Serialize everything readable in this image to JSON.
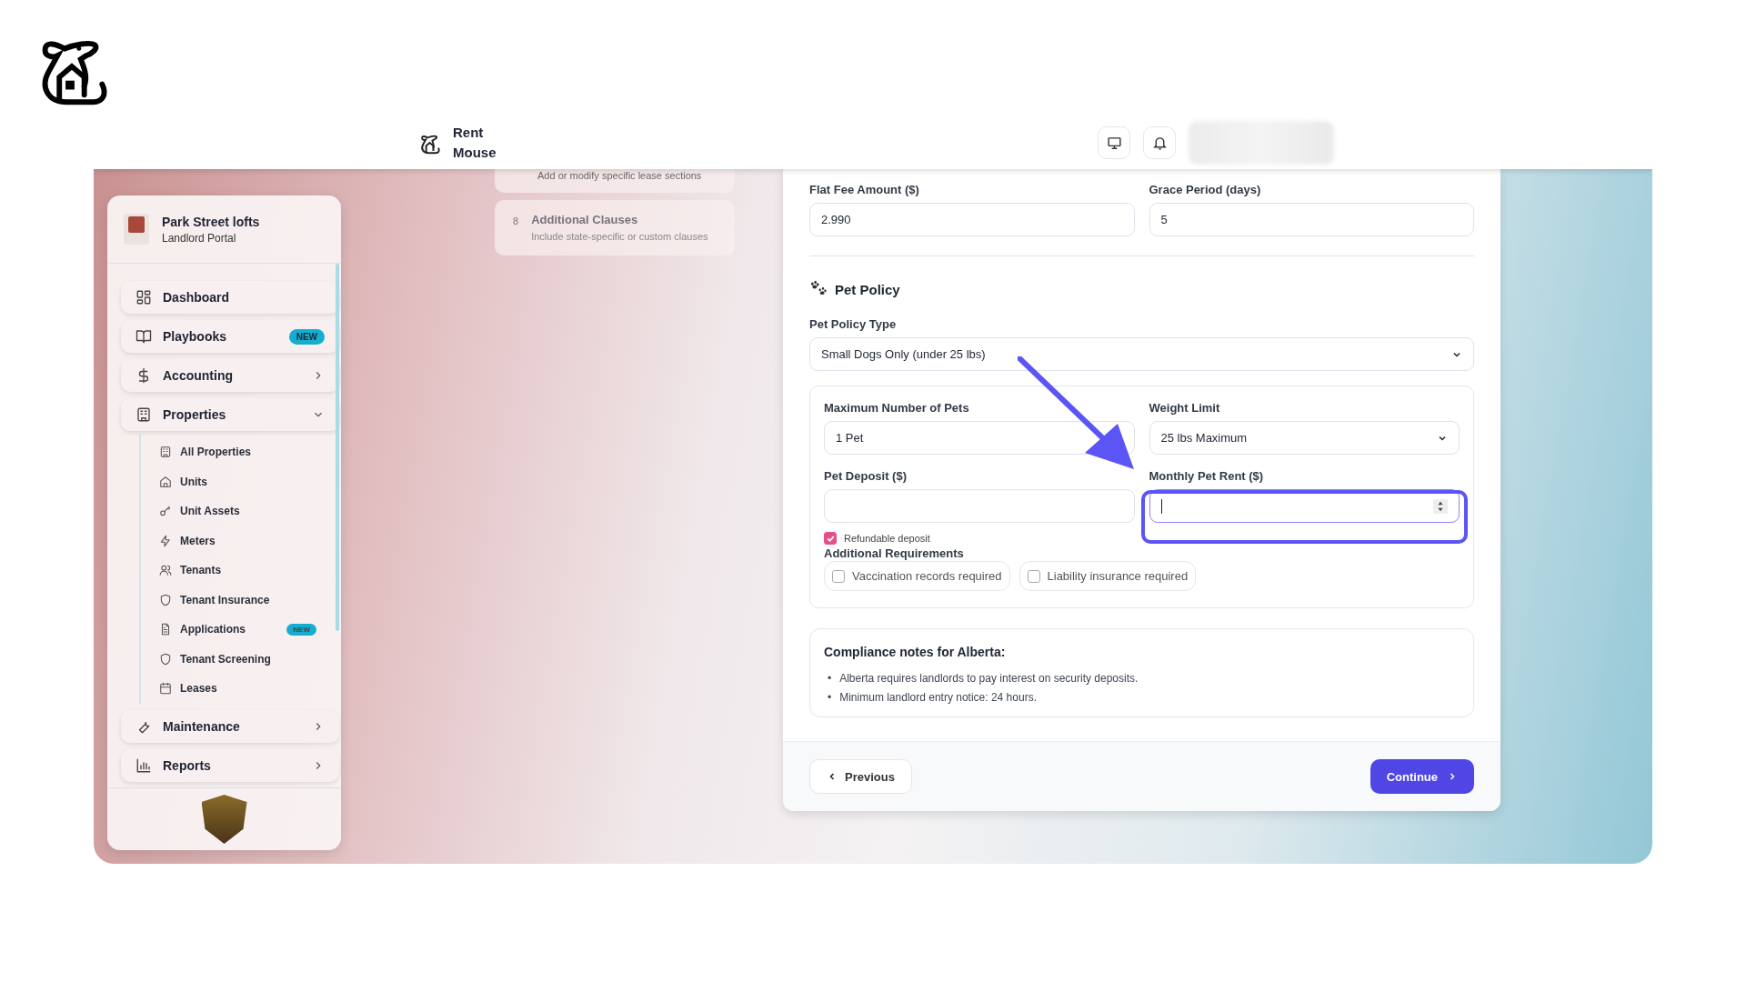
{
  "header": {
    "brand": "Rent Mouse"
  },
  "sidebar": {
    "org_name": "Park Street lofts",
    "org_subtitle": "Landlord Portal",
    "items": [
      {
        "label": "Dashboard"
      },
      {
        "label": "Playbooks",
        "badge": "NEW"
      },
      {
        "label": "Accounting",
        "expanded": false
      },
      {
        "label": "Properties",
        "expanded": true,
        "children": [
          {
            "label": "All Properties"
          },
          {
            "label": "Units"
          },
          {
            "label": "Unit Assets"
          },
          {
            "label": "Meters"
          },
          {
            "label": "Tenants"
          },
          {
            "label": "Tenant Insurance"
          },
          {
            "label": "Applications",
            "badge": "NEW"
          },
          {
            "label": "Tenant Screening"
          },
          {
            "label": "Leases"
          }
        ]
      },
      {
        "label": "Maintenance",
        "expanded": false
      },
      {
        "label": "Reports",
        "expanded": false
      }
    ]
  },
  "steps": [
    {
      "description": "Add or modify specific lease sections"
    },
    {
      "number": "8",
      "title": "Additional Clauses",
      "description": "Include state-specific or custom clauses"
    }
  ],
  "form": {
    "fee_fields": [
      {
        "label": "Flat Fee Amount ($)",
        "value": "2.990"
      },
      {
        "label": "Grace Period (days)",
        "value": "5"
      }
    ],
    "pet_policy": {
      "title": "Pet Policy",
      "type_label": "Pet Policy Type",
      "type_value": "Small Dogs Only (under 25 lbs)",
      "max_pets": {
        "label": "Maximum Number of Pets",
        "value": "1 Pet"
      },
      "weight_limit": {
        "label": "Weight Limit",
        "value": "25 lbs Maximum"
      },
      "deposit": {
        "label": "Pet Deposit ($)"
      },
      "monthly_rent": {
        "label": "Monthly Pet Rent ($)",
        "focused": true
      },
      "refundable": {
        "label": "Refundable deposit",
        "checked": true
      },
      "requirements_label": "Additional Requirements",
      "requirements": [
        {
          "label": "Vaccination records required",
          "checked": false
        },
        {
          "label": "Liability insurance required",
          "checked": false
        }
      ]
    },
    "compliance": {
      "title": "Compliance notes for Alberta:",
      "notes": [
        {
          "bullet": "•",
          "text": "Alberta requires landlords to pay interest on security deposits."
        },
        {
          "bullet": "•",
          "text": "Minimum landlord entry notice: 24 hours."
        }
      ]
    },
    "previous": "Previous",
    "continue": "Continue"
  }
}
